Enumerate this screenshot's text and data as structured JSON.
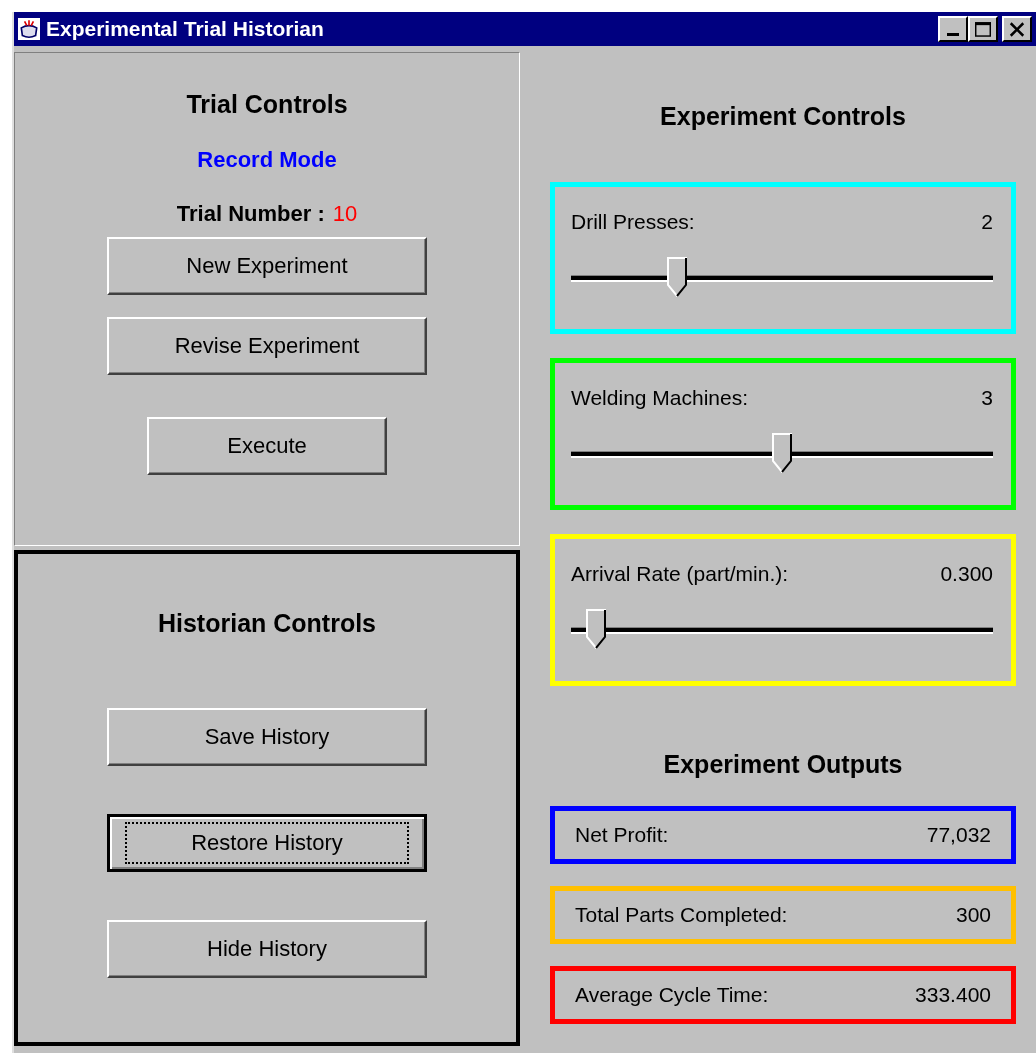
{
  "window": {
    "title": "Experimental Trial Historian"
  },
  "trial_controls": {
    "title": "Trial Controls",
    "mode": "Record Mode",
    "trial_label": "Trial Number :",
    "trial_number": "10",
    "buttons": [
      {
        "label": "New Experiment",
        "focused": false
      },
      {
        "label": "Revise Experiment",
        "focused": false
      },
      {
        "label": "Execute",
        "focused": false
      }
    ]
  },
  "historian_controls": {
    "title": "Historian Controls",
    "buttons": [
      {
        "label": "Save History",
        "focused": false
      },
      {
        "label": "Restore History",
        "focused": true
      },
      {
        "label": "Hide History",
        "focused": false
      }
    ]
  },
  "experiment_controls": {
    "title": "Experiment Controls",
    "sliders": [
      {
        "label": "Drill Presses:",
        "value": "2",
        "level": 0.25,
        "color": "#00ffff"
      },
      {
        "label": "Welding Machines:",
        "value": "3",
        "level": 0.5,
        "color": "#00ff00"
      },
      {
        "label": "Arrival Rate (part/min.):",
        "value": "0.300",
        "level": 0.06,
        "color": "#ffff00"
      }
    ]
  },
  "experiment_outputs": {
    "title": "Experiment Outputs",
    "items": [
      {
        "label": "Net Profit:",
        "value": "77,032",
        "color": "#0000ff"
      },
      {
        "label": "Total Parts Completed:",
        "value": "300",
        "color": "#ffc000"
      },
      {
        "label": "Average Cycle Time:",
        "value": "333.400",
        "color": "#ff0000"
      }
    ]
  }
}
